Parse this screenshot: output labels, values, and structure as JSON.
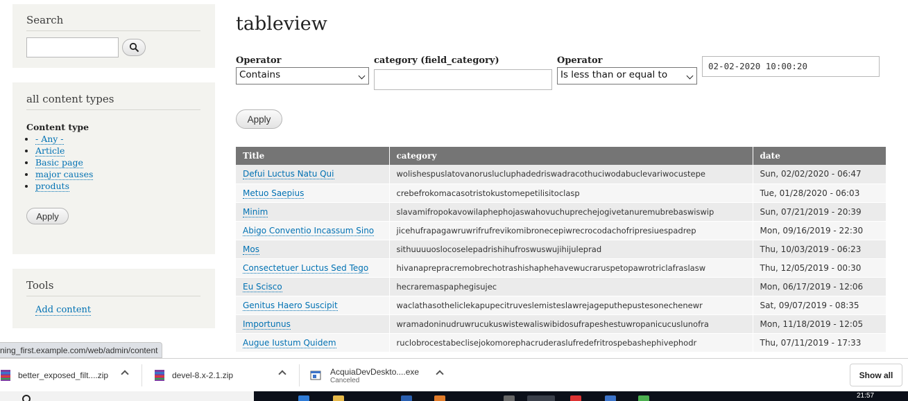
{
  "sidebar": {
    "search": {
      "title": "Search",
      "input_value": ""
    },
    "content_types": {
      "title": "all content types",
      "label": "Content type",
      "options": [
        "- Any -",
        "Article",
        "Basic page",
        "major causes",
        "produts"
      ],
      "apply_label": "Apply"
    },
    "tools": {
      "title": "Tools",
      "link": "Add content"
    }
  },
  "status_url": "ning_first.example.com/web/admin/content",
  "main": {
    "title": "tableview",
    "filters": {
      "operator1_label": "Operator",
      "operator1_value": "Contains",
      "category_label": "category (field_category)",
      "category_value": "",
      "operator2_label": "Operator",
      "operator2_value": "Is less than or equal to",
      "date_value": "02-02-2020 10:00:20",
      "apply_label": "Apply"
    },
    "table": {
      "headers": [
        "Title",
        "category",
        "date"
      ],
      "rows": [
        [
          "Defui Luctus Natu Qui",
          "wolishespuslatovanoruslucluphadedriswadracothuciwodabuclevariwocustepe",
          "Sun, 02/02/2020 - 06:47"
        ],
        [
          "Metuo Saepius",
          "crebefrokomacasotristokustomepetilisitoclasp",
          "Tue, 01/28/2020 - 06:03"
        ],
        [
          "Minim",
          "slavamifropokavowilaphephojaswahovuchuprechejogivetanuremubrebaswiswip",
          "Sun, 07/21/2019 - 20:39"
        ],
        [
          "Abigo Conventio Incassum Sino",
          "jicehufrapagawruwrifrufrevikomibronecepiwrecrocodachofripresiuespadrep",
          "Mon, 09/16/2019 - 22:30"
        ],
        [
          "Mos",
          "sithuuuuoslocoselepadrishihufroswuswujihijuleprad",
          "Thu, 10/03/2019 - 06:23"
        ],
        [
          "Consectetuer Luctus Sed Tego",
          "hivanaprepracremobrechotrashishaphehavewucraruspetopawrotriclafraslasw",
          "Thu, 12/05/2019 - 00:30"
        ],
        [
          "Eu Scisco",
          "hecraremaspaphegisujec",
          "Mon, 06/17/2019 - 12:06"
        ],
        [
          "Genitus Haero Suscipit",
          "waclathasotheliclekapupecitruveslemisteslawrejageputhepustesonechenewr",
          "Sat, 09/07/2019 - 08:35"
        ],
        [
          "Importunus",
          "wramadoninudruwrucukuswistewaliswibidosufrapeshestuwropanicucuslunofra",
          "Mon, 11/18/2019 - 12:05"
        ],
        [
          "Augue Iustum Quidem",
          "ruclobrocestabeclisejokomorephacruderaslufredefritrospebashephivephodr",
          "Thu, 07/11/2019 - 17:33"
        ]
      ]
    }
  },
  "downloads": {
    "items": [
      {
        "name": "better_exposed_filt....zip",
        "status": ""
      },
      {
        "name": "devel-8.x-2.1.zip",
        "status": ""
      },
      {
        "name": "AcquiaDevDeskto....exe",
        "status": "Canceled"
      }
    ],
    "show_all": "Show all"
  },
  "taskbar": {
    "clock": "21:57"
  },
  "colors": {
    "link": "#0071b3",
    "table_header": "#757575",
    "sidebar_bg": "#f3f3ef"
  }
}
